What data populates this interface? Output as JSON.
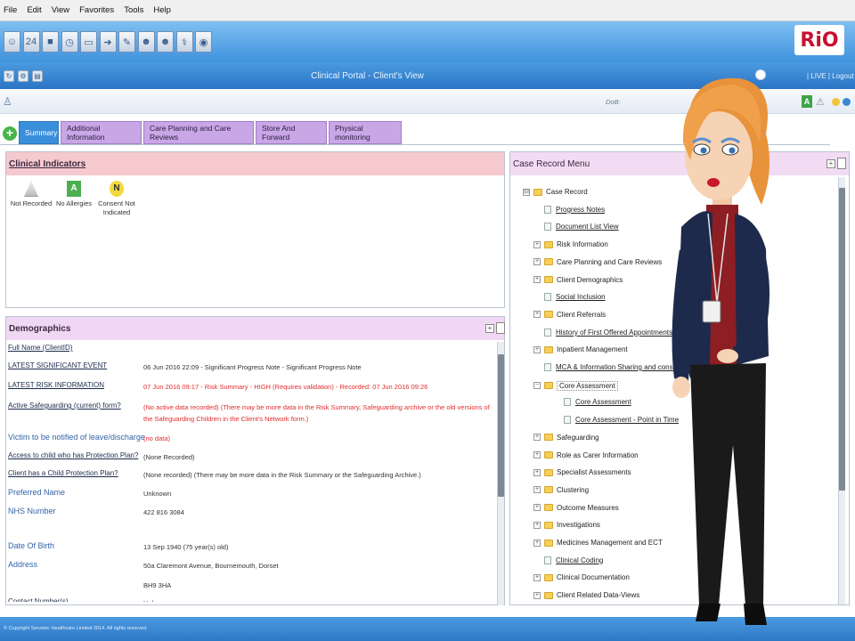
{
  "menu": [
    "File",
    "Edit",
    "View",
    "Favorites",
    "Tools",
    "Help"
  ],
  "toolbar": {
    "icons": [
      "person-icon",
      "calendar-icon",
      "terminal-icon",
      "clock-icon",
      "monitor-icon",
      "arrow-icon",
      "pen-icon",
      "group-icon",
      "group-icon",
      "ambulance-icon",
      "globe-icon"
    ],
    "icon_glyphs": [
      "☺",
      "24",
      "■",
      "◷",
      "▭",
      "➜",
      "✎",
      "☻",
      "☻",
      "⚕",
      "◉"
    ],
    "logo": "RiO"
  },
  "titlebar": {
    "title": "Clinical Portal - Client's View",
    "live_logout": "| LIVE | Logout"
  },
  "patientbar": {
    "dob_text": "DoB:",
    "badge": "A"
  },
  "tabs": [
    {
      "label": "Summary",
      "active": true
    },
    {
      "label": "Additional Information",
      "active": false
    },
    {
      "label": "Care Planning and Care Reviews",
      "active": false
    },
    {
      "label": "Store And Forward",
      "active": false
    },
    {
      "label": "Physical monitoring",
      "active": false
    }
  ],
  "clinical_indicators": {
    "title": "Clinical Indicators",
    "items": [
      {
        "glyph": "!",
        "label": "Not Recorded"
      },
      {
        "glyph": "A",
        "label": "No Allergies"
      },
      {
        "glyph": "N",
        "label": "Consent Not Indicated"
      }
    ]
  },
  "demographics": {
    "title": "Demographics",
    "rows": [
      {
        "label": "Full Name (ClientID)",
        "value": ""
      },
      {
        "label": "LATEST SIGNIFICANT EVENT",
        "value": "06 Jun 2016 22:09 - Significant Progress Note - Significant Progress Note"
      },
      {
        "label": "LATEST RISK INFORMATION",
        "value": "07 Jun 2016 09:17 - Risk Summary - HIGH (Requires validation) - Recorded: 07 Jun 2016 09:26"
      },
      {
        "label": "Active Safeguarding (current) form?",
        "value": "(No active data recorded) (There may be more data in the Risk Summary, Safeguarding archive or the old versions of the Safeguarding Children in the Client's Network form.)"
      },
      {
        "label": "Victim to be notified of leave/discharge",
        "value": "(no data)"
      },
      {
        "label": "Access to child who has Protection Plan?",
        "value": "(None Recorded)"
      },
      {
        "label": "Client has a Child Protection Plan?",
        "value": "(None recorded) (There may be more data in the Risk Summary or the Safeguarding Archive.)"
      },
      {
        "label": "Preferred Name",
        "value": "Unknown"
      },
      {
        "label": "NHS Number",
        "value": "422 816 3084"
      },
      {
        "label": "Date Of Birth",
        "value": "13 Sep 1940 (75 year(s) old)"
      },
      {
        "label": "Address",
        "value": "50a Claremont Avenue, Bournemouth, Dorset"
      },
      {
        "label": "",
        "value": "BH9 3HA"
      },
      {
        "label": "Contact Number(s)",
        "value": "Unknown"
      }
    ]
  },
  "case_record": {
    "title": "Case Record Menu",
    "items": [
      {
        "label": "Case Record",
        "type": "folder",
        "toggle": "⊟",
        "level": 0
      },
      {
        "label": "Progress Notes",
        "type": "doc",
        "level": 1
      },
      {
        "label": "Document List View",
        "type": "doc",
        "level": 1
      },
      {
        "label": "Risk Information",
        "type": "folder",
        "toggle": "+",
        "level": 1
      },
      {
        "label": "Care Planning and Care Reviews",
        "type": "folder",
        "toggle": "+",
        "level": 1
      },
      {
        "label": "Client Demographics",
        "type": "folder",
        "toggle": "+",
        "level": 1
      },
      {
        "label": "Social Inclusion",
        "type": "doc",
        "level": 1
      },
      {
        "label": "Client Referrals",
        "type": "folder",
        "toggle": "+",
        "level": 1
      },
      {
        "label": "History of First Offered Appointments",
        "type": "doc",
        "level": 1
      },
      {
        "label": "Inpatient Management",
        "type": "folder",
        "toggle": "+",
        "level": 1
      },
      {
        "label": "MCA & Information Sharing and consent",
        "type": "doc",
        "level": 1
      },
      {
        "label": "Core Assessment",
        "type": "folder",
        "toggle": "−",
        "level": 1,
        "selected": true
      },
      {
        "label": "Core Assessment",
        "type": "doc",
        "level": 2
      },
      {
        "label": "Core Assessment - Point in Time",
        "type": "doc",
        "level": 2
      },
      {
        "label": "Safeguarding",
        "type": "folder",
        "toggle": "+",
        "level": 1
      },
      {
        "label": "Role as Carer Information",
        "type": "folder",
        "toggle": "+",
        "level": 1
      },
      {
        "label": "Specialist Assessments",
        "type": "folder",
        "toggle": "+",
        "level": 1
      },
      {
        "label": "Clustering",
        "type": "folder",
        "toggle": "+",
        "level": 1
      },
      {
        "label": "Outcome Measures",
        "type": "folder",
        "toggle": "+",
        "level": 1
      },
      {
        "label": "Investigations",
        "type": "folder",
        "toggle": "+",
        "level": 1
      },
      {
        "label": "Medicines Management and ECT",
        "type": "folder",
        "toggle": "+",
        "level": 1
      },
      {
        "label": "Clinical Coding",
        "type": "doc",
        "level": 1
      },
      {
        "label": "Clinical Documentation",
        "type": "folder",
        "toggle": "+",
        "level": 1
      },
      {
        "label": "Client Related Data-Views",
        "type": "folder",
        "toggle": "+",
        "level": 1
      }
    ]
  },
  "footer": {
    "copyright": "© Copyright Servelec Healthcare Limited 2014. All rights reserved."
  },
  "colors": {
    "toolbar": "#3f92dd",
    "active_tab": "#3a8fdb",
    "inactive_tab": "#c9a6e6",
    "risk_red": "#e42c2c",
    "ci_header": "#f6c9cf"
  }
}
